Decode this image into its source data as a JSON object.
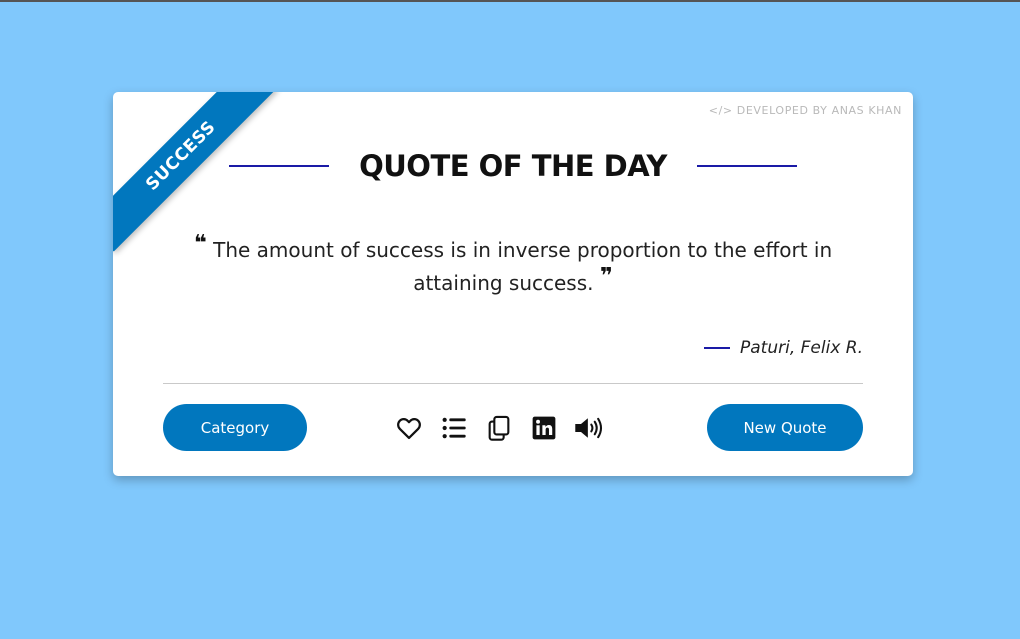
{
  "card": {
    "ribbon_label": "SUCCESS",
    "credit": "</> DEVELOPED BY ANAS KHAN",
    "title": "QUOTE OF THE DAY",
    "quote": {
      "open_mark": "❝",
      "text": "The amount of success is in inverse proportion to the effort in attaining success.",
      "close_mark": "❞"
    },
    "author": "Paturi, Felix R."
  },
  "actions": {
    "category_label": "Category",
    "new_quote_label": "New Quote",
    "icons": [
      "heart-icon",
      "list-icon",
      "copy-icon",
      "linkedin-icon",
      "speaker-icon"
    ]
  },
  "colors": {
    "background": "#80c8fc",
    "accent": "#0177be",
    "line_accent": "#1a1aa6"
  }
}
